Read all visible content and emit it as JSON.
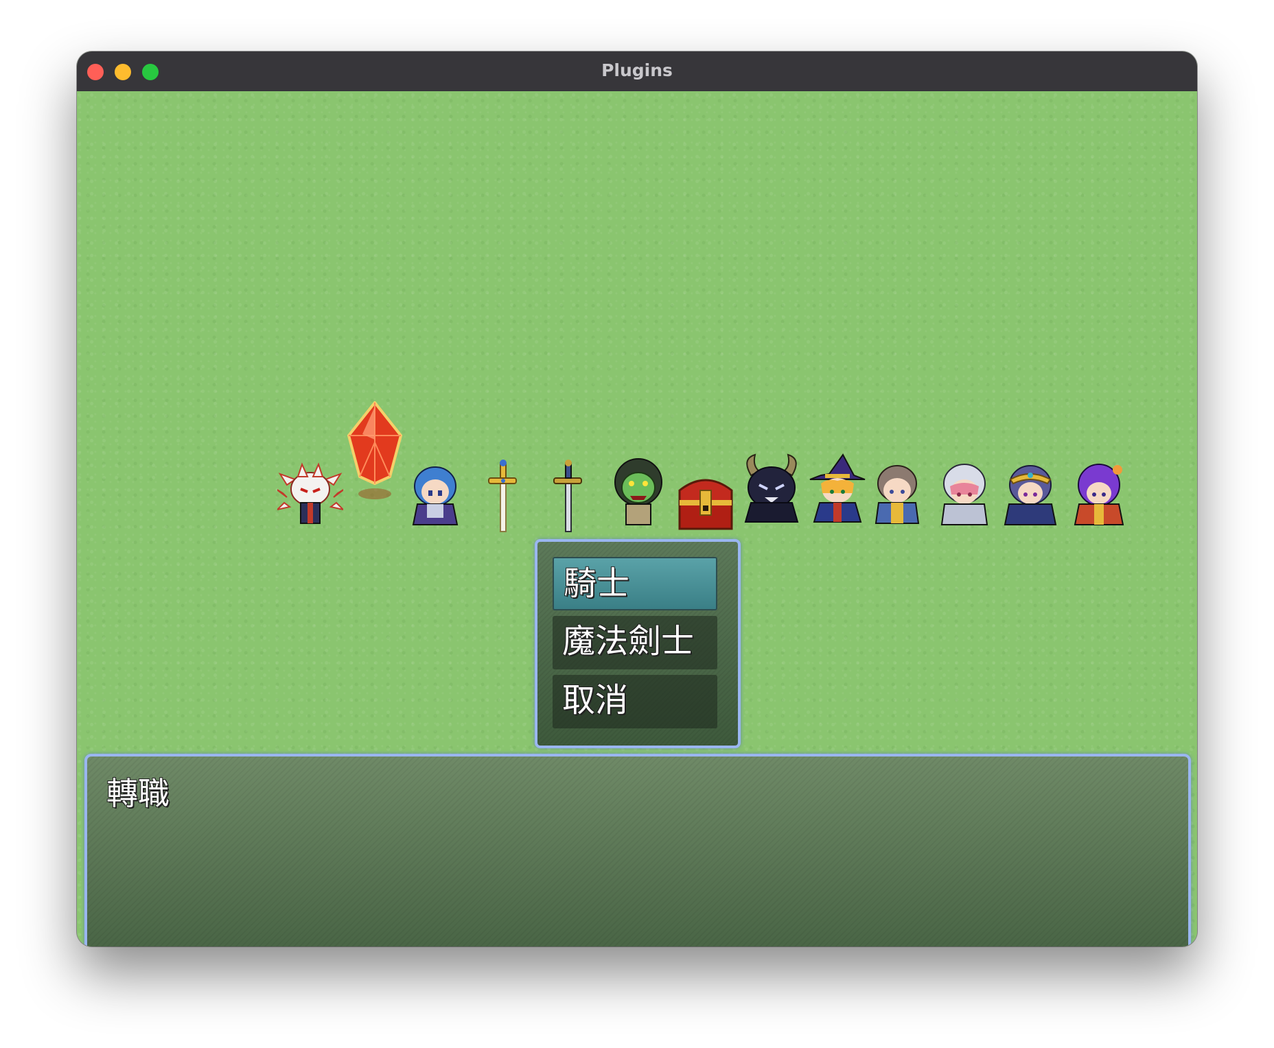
{
  "window": {
    "title": "Plugins"
  },
  "colors": {
    "grass": "#8ac56f",
    "window_border": "#9ab6f0",
    "selected_choice": "#4b939a",
    "titlebar": "#37363a"
  },
  "sprites": [
    {
      "name": "white-fox-demon-sprite",
      "icon": "fox-demon"
    },
    {
      "name": "red-crystal-sprite",
      "icon": "crystal"
    },
    {
      "name": "blue-haired-hero-sprite",
      "icon": "hero-blue"
    },
    {
      "name": "golden-sword-sprite",
      "icon": "sword-gold"
    },
    {
      "name": "steel-sword-sprite",
      "icon": "sword-steel"
    },
    {
      "name": "green-orc-sprite",
      "icon": "orc"
    },
    {
      "name": "treasure-chest-sprite",
      "icon": "chest"
    },
    {
      "name": "horned-demon-sprite",
      "icon": "demon"
    },
    {
      "name": "witch-sprite",
      "icon": "witch"
    },
    {
      "name": "brown-haired-boy-sprite",
      "icon": "boy"
    },
    {
      "name": "pink-haired-knight-sprite",
      "icon": "knight-pink"
    },
    {
      "name": "circlet-mage-sprite",
      "icon": "mage"
    },
    {
      "name": "purple-haired-girl-sprite",
      "icon": "girl-purple"
    }
  ],
  "choices": {
    "items": [
      "騎士",
      "魔法劍士",
      "取消"
    ],
    "selected_index": 0
  },
  "message": {
    "text": "轉職"
  }
}
